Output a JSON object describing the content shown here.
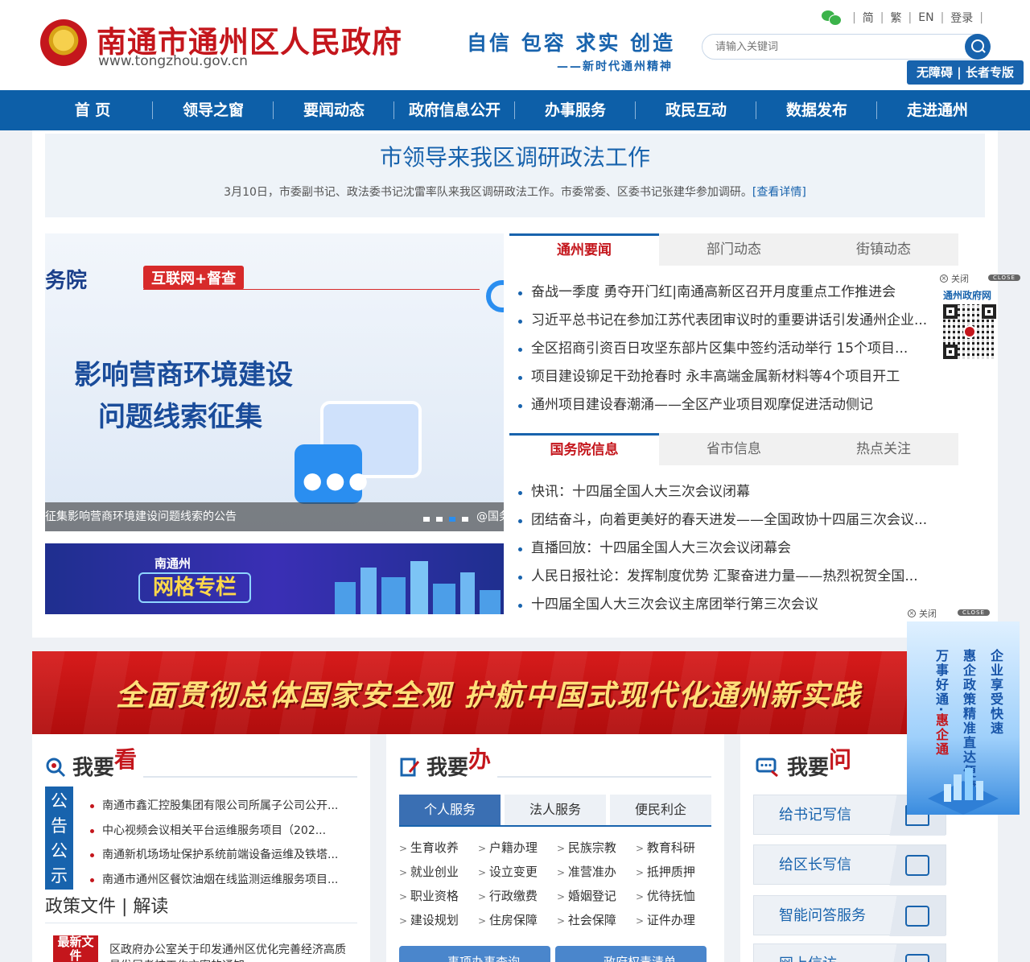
{
  "header": {
    "site_title": "南通市通州区人民政府",
    "site_url": "www.tongzhou.gov.cn",
    "slogan": "自信 包容 求实 创造",
    "slogan_sub": "——新时代通州精神",
    "top_links": [
      "简",
      "繁",
      "EN",
      "登录"
    ],
    "search_placeholder": "请输入关键词",
    "accessibility_label": "无障碍 | 长者专版"
  },
  "nav": [
    "首 页",
    "领导之窗",
    "要闻动态",
    "政府信息公开",
    "办事服务",
    "政民互动",
    "数据发布",
    "走进通州"
  ],
  "headline": {
    "title": "市领导来我区调研政法工作",
    "desc": "3月10日，市委副书记、政法委书记沈雷率队来我区调研政法工作。市委常委、区委书记张建华参加调研。",
    "more": "[查看详情]"
  },
  "carousel": {
    "brand": "务院",
    "tag": "互联网+督查",
    "line1": "影响营商环境建设",
    "line2": "问题线索征集",
    "caption": "征集影响营商环境建设问题线索的公告",
    "caption_tail": "@国务"
  },
  "grid_banner": {
    "logo": "南通州",
    "title": "网格专栏"
  },
  "news_tabs1": [
    "通州要闻",
    "部门动态",
    "街镇动态"
  ],
  "news_list1": [
    "奋战一季度 勇夺开门红|南通高新区召开月度重点工作推进会",
    "习近平总书记在参加江苏代表团审议时的重要讲话引发通州企业...",
    "全区招商引资百日攻坚东部片区集中签约活动举行 15个项目...",
    "项目建设铆足干劲抢春时 永丰高端金属新材料等4个项目开工",
    "通州项目建设春潮涌——全区产业项目观摩促进活动侧记"
  ],
  "news_tabs2": [
    "国务院信息",
    "省市信息",
    "热点关注"
  ],
  "news_list2": [
    "快讯：十四届全国人大三次会议闭幕",
    "团结奋斗，向着更美好的春天进发——全国政协十四届三次会议...",
    "直播回放：十四届全国人大三次会议闭幕会",
    "人民日报社论：发挥制度优势 汇聚奋进力量——热烈祝贺全国...",
    "十四届全国人大三次会议主席团举行第三次会议"
  ],
  "float_qr": {
    "close": "关闭",
    "badge": "CLOSE",
    "label": "通州政府网"
  },
  "red_banner": "全面贯彻总体国家安全观  护航中国式现代化通州新实践",
  "panel_see": {
    "title": "我要",
    "accent": "看",
    "notice_side": [
      "公",
      "告",
      "公",
      "示"
    ],
    "notices": [
      "南通市鑫汇控股集团有限公司所属子公司公开...",
      "中心视频会议相关平台运维服务项目（202...",
      "南通新机场场址保护系统前端设备运维及铁塔...",
      "南通市通州区餐饮油烟在线监测运维服务项目..."
    ],
    "policy_head": "政策文件 | 解读",
    "policy_tag": "最新文件",
    "policy_item": "区政府办公室关于印发通州区优化完善经济高质量发展考核工作方案的通知"
  },
  "panel_do": {
    "title": "我要",
    "accent": "办",
    "tabs": [
      "个人服务",
      "法人服务",
      "便民利企"
    ],
    "services": [
      "生育收养",
      "户籍办理",
      "民族宗教",
      "教育科研",
      "就业创业",
      "设立变更",
      "准营准办",
      "抵押质押",
      "职业资格",
      "行政缴费",
      "婚姻登记",
      "优待抚恤",
      "建设规划",
      "住房保障",
      "社会保障",
      "证件办理"
    ],
    "buttons": [
      "事项办事查询",
      "政府权责清单"
    ]
  },
  "panel_ask": {
    "title": "我要",
    "accent": "问",
    "items": [
      "给书记写信",
      "给区长写信",
      "智能问答服务",
      "网上信访"
    ]
  },
  "float_ad": {
    "close": "关闭",
    "badge": "CLOSE",
    "col1": "企业享受快速",
    "col2": "惠企政策精准直达便捷",
    "col3_a": "万事好通·",
    "col3_b": "惠企通"
  },
  "colors": {
    "brand_blue": "#1863ad",
    "nav_blue": "#0d5fa8",
    "brand_red": "#c4161c"
  }
}
